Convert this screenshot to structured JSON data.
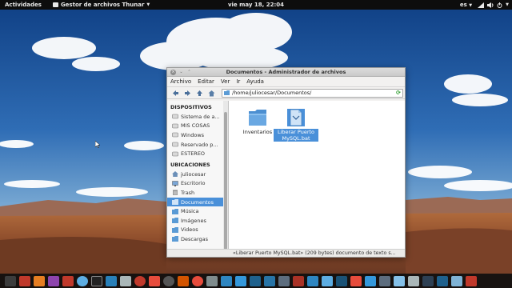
{
  "panel": {
    "activities": "Actividades",
    "app_menu": "Gestor de archivos Thunar",
    "clock": "vie may 18, 22:04",
    "keyboard": "es"
  },
  "window": {
    "title": "Documentos - Administrador de archivos"
  },
  "menubar": [
    "Archivo",
    "Editar",
    "Ver",
    "Ir",
    "Ayuda"
  ],
  "location": "/home/juliocesar/Documentos/",
  "sidebar": {
    "devices_heading": "DISPOSITIVOS",
    "devices": [
      {
        "label": "Sistema de a...",
        "icon": "drive-icon"
      },
      {
        "label": "MIS COSAS",
        "icon": "drive-icon"
      },
      {
        "label": "Windows",
        "icon": "drive-icon"
      },
      {
        "label": "Reservado p...",
        "icon": "drive-icon"
      },
      {
        "label": "ESTEREO",
        "icon": "drive-icon"
      }
    ],
    "places_heading": "UBICACIONES",
    "places": [
      {
        "label": "juliocesar",
        "icon": "home-icon"
      },
      {
        "label": "Escritorio",
        "icon": "desktop-icon"
      },
      {
        "label": "Trash",
        "icon": "trash-icon"
      },
      {
        "label": "Documentos",
        "icon": "folder-icon",
        "selected": true
      },
      {
        "label": "Música",
        "icon": "music-icon"
      },
      {
        "label": "Imágenes",
        "icon": "pictures-icon"
      },
      {
        "label": "Videos",
        "icon": "videos-icon"
      },
      {
        "label": "Descargas",
        "icon": "downloads-icon"
      }
    ]
  },
  "files": [
    {
      "name": "Inventarios",
      "type": "folder"
    },
    {
      "name": "Liberar Puerto MySQL.bat",
      "type": "file",
      "selected": true
    }
  ],
  "statusbar": "«Liberar Puerto MySQL.bat» (209 bytes) documento de texto s...",
  "colors": {
    "selection": "#4a90d9",
    "panel": "#0d0d0d"
  }
}
